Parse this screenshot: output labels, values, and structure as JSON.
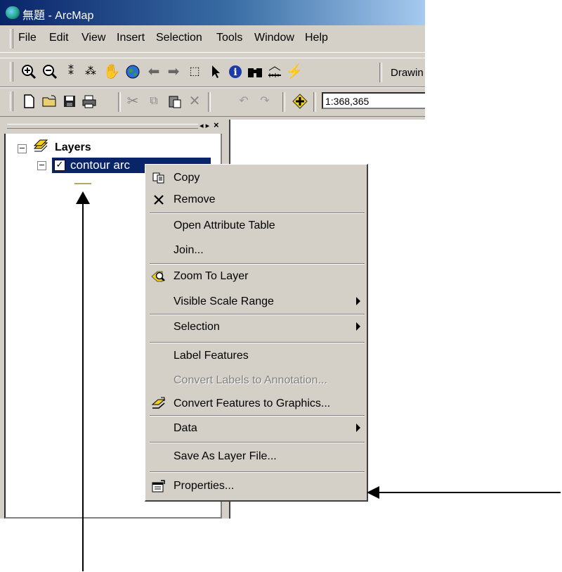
{
  "window": {
    "title": "無題 - ArcMap"
  },
  "menubar": [
    "File",
    "Edit",
    "View",
    "Insert",
    "Selection",
    "Tools",
    "Window",
    "Help"
  ],
  "toolbar1": {
    "drawing_label": "Drawin"
  },
  "toolbar2": {
    "scale_value": "1:368,365"
  },
  "toc": {
    "root_label": "Layers",
    "layer_label": "contour arc",
    "layer_checked": true
  },
  "context_menu": {
    "items": [
      {
        "label": "Copy",
        "icon": "copy-icon",
        "enabled": true,
        "submenu": false
      },
      {
        "label": "Remove",
        "icon": "remove-icon",
        "enabled": true,
        "submenu": false
      },
      {
        "label": "Open Attribute Table",
        "icon": "",
        "enabled": true,
        "submenu": false
      },
      {
        "label": "Join...",
        "icon": "",
        "enabled": true,
        "submenu": false
      },
      {
        "label": "Zoom To Layer",
        "icon": "zoom-to-layer-icon",
        "enabled": true,
        "submenu": false
      },
      {
        "label": "Visible Scale Range",
        "icon": "",
        "enabled": true,
        "submenu": true
      },
      {
        "label": "Selection",
        "icon": "",
        "enabled": true,
        "submenu": true
      },
      {
        "label": "Label Features",
        "icon": "",
        "enabled": true,
        "submenu": false
      },
      {
        "label": "Convert Labels to Annotation...",
        "icon": "",
        "enabled": false,
        "submenu": false
      },
      {
        "label": "Convert Features to Graphics...",
        "icon": "convert-graphics-icon",
        "enabled": true,
        "submenu": false
      },
      {
        "label": "Data",
        "icon": "",
        "enabled": true,
        "submenu": true
      },
      {
        "label": "Save As Layer File...",
        "icon": "",
        "enabled": true,
        "submenu": false
      },
      {
        "label": "Properties...",
        "icon": "properties-icon",
        "enabled": true,
        "submenu": false
      }
    ]
  },
  "colors": {
    "selection": "#0a246a",
    "face": "#d4d0c8",
    "title_start": "#0a246a"
  }
}
